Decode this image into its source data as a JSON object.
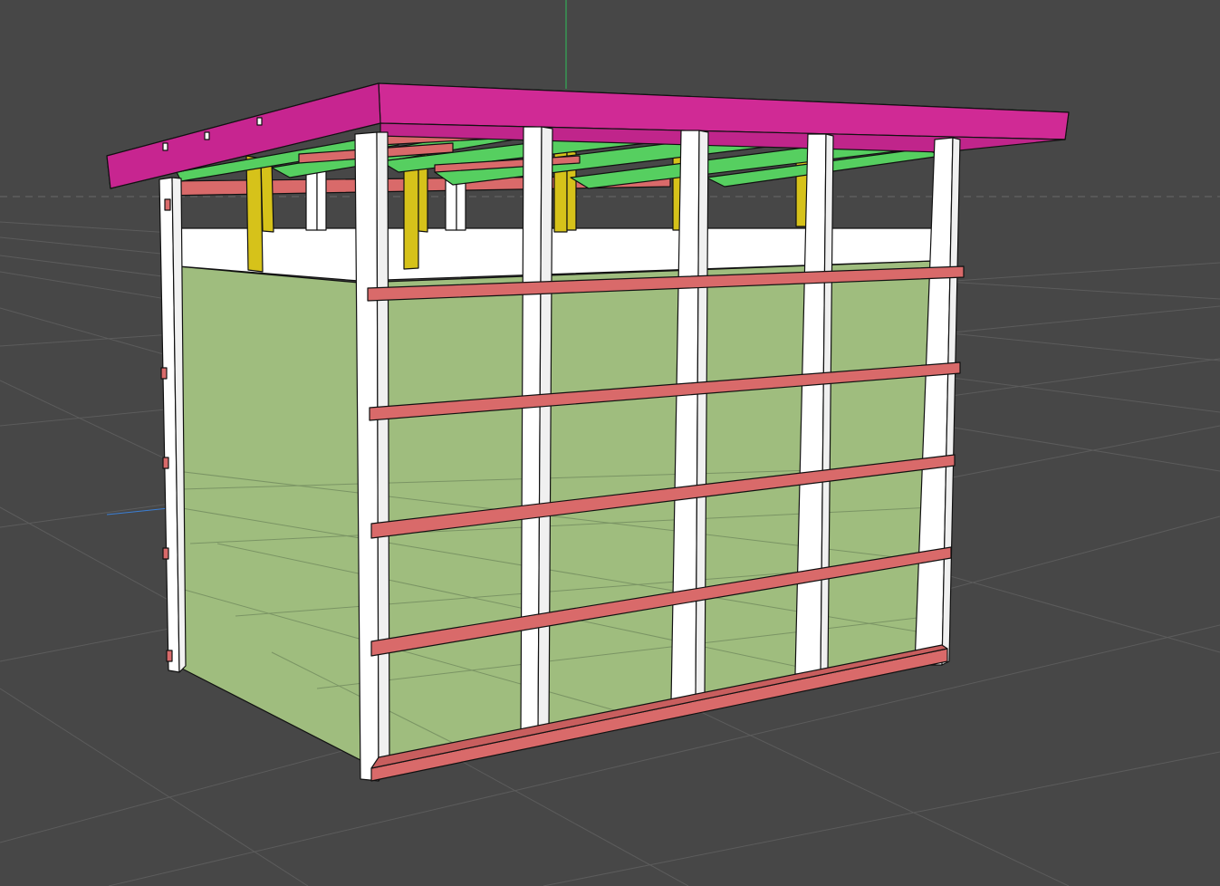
{
  "viewport": {
    "background": "#474747",
    "grid_color": "#5c5c5c",
    "horizon_color": "#6a6a6a",
    "axis_y_color": "#2fbf5a",
    "axis_x_color": "#3a7fd6"
  },
  "model": {
    "roof_panel_color": "#d72a9a",
    "rafter_color": "#56cf60",
    "plate_color": "#d96a6a",
    "stud_color": "#ffffff",
    "block_color": "#d6c21a",
    "sheathing_color": "#9fbd7e",
    "edge_color": "#111111"
  },
  "parts": {
    "front_studs_count": 5,
    "front_girts_count": 5,
    "roof_rafters_count": 6
  }
}
